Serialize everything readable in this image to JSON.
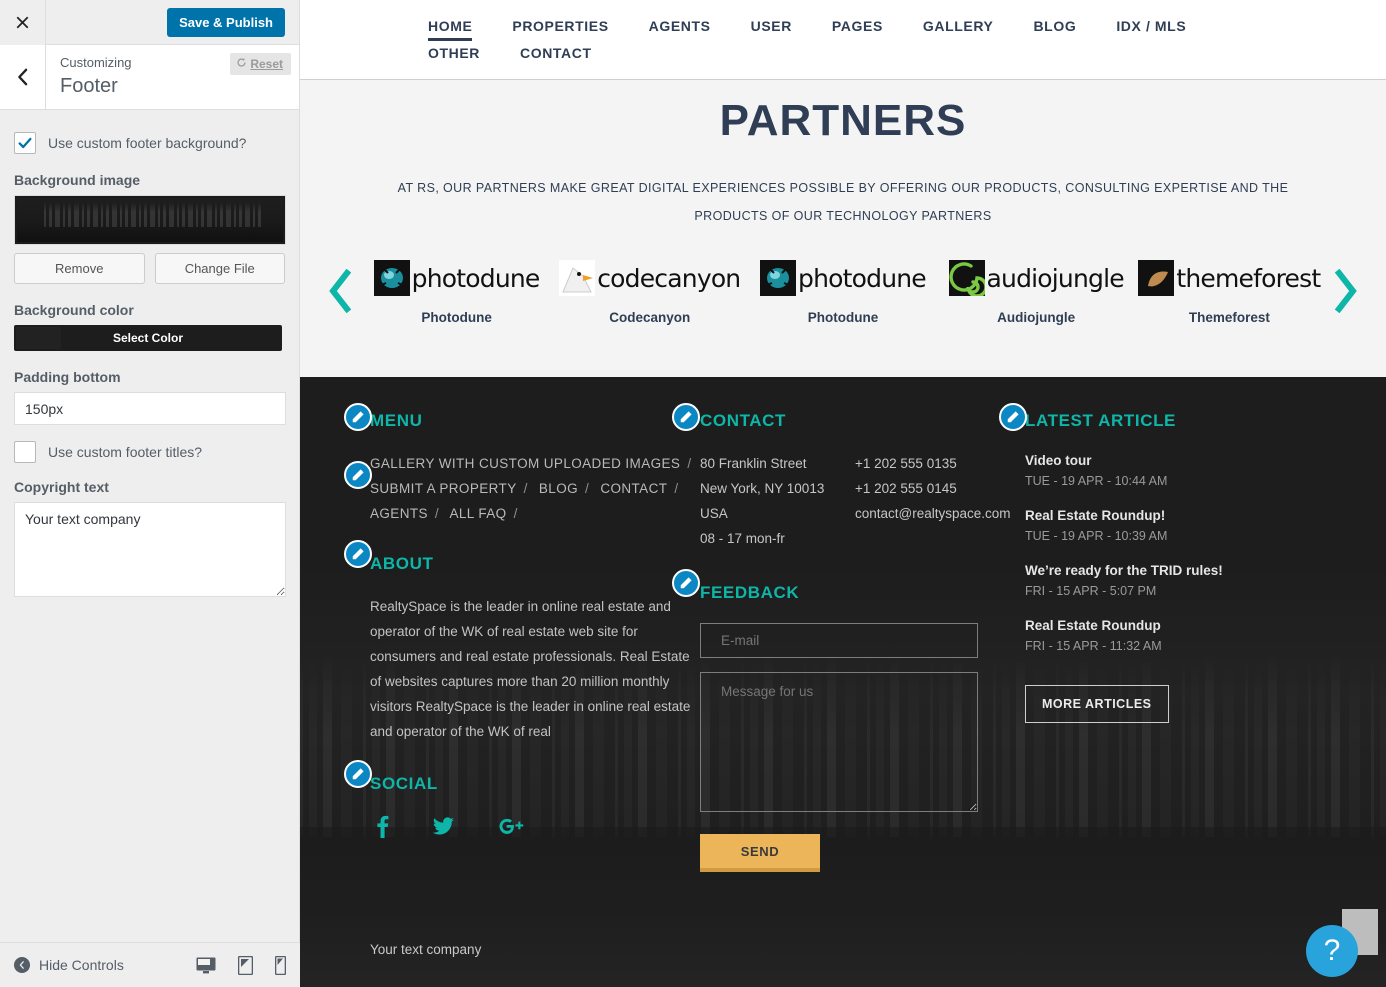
{
  "sidebar": {
    "close_icon": "close-icon",
    "save_button": "Save & Publish",
    "back_icon": "chevron-left-icon",
    "customizing_label": "Customizing",
    "panel_title": "Footer",
    "reset_button": "Reset",
    "controls": {
      "custom_bg_checkbox_label": "Use custom footer background?",
      "custom_bg_checked": true,
      "background_image_label": "Background image",
      "remove_button": "Remove",
      "change_file_button": "Change File",
      "background_color_label": "Background color",
      "select_color_button": "Select Color",
      "background_color_value": "#222222",
      "padding_bottom_label": "Padding bottom",
      "padding_bottom_value": "150px",
      "custom_titles_checkbox_label": "Use custom footer titles?",
      "custom_titles_checked": false,
      "copyright_label": "Copyright text",
      "copyright_value": "Your text company"
    },
    "footer_bar": {
      "hide_controls_label": "Hide Controls",
      "devices": [
        "desktop-icon",
        "tablet-icon",
        "mobile-icon"
      ]
    }
  },
  "preview": {
    "nav": {
      "items": [
        {
          "label": "HOME",
          "active": true
        },
        {
          "label": "PROPERTIES",
          "active": false
        },
        {
          "label": "AGENTS",
          "active": false
        },
        {
          "label": "USER",
          "active": false
        },
        {
          "label": "PAGES",
          "active": false
        },
        {
          "label": "GALLERY",
          "active": false
        },
        {
          "label": "BLOG",
          "active": false
        },
        {
          "label": "IDX / MLS",
          "active": false
        },
        {
          "label": "OTHER",
          "active": false
        },
        {
          "label": "CONTACT",
          "active": false
        }
      ]
    },
    "partners": {
      "title": "PARTNERS",
      "subtitle": "AT RS, OUR PARTNERS MAKE GREAT DIGITAL EXPERIENCES POSSIBLE BY OFFERING OUR PRODUCTS, CONSULTING EXPERTISE AND THE PRODUCTS OF OUR TECHNOLOGY PARTNERS",
      "prev_arrow": "chevron-left-icon",
      "next_arrow": "chevron-right-icon",
      "arrow_color": "#0db6a8",
      "items": [
        {
          "logo_word": "photodune",
          "caption": "Photodune",
          "mark": "photodune-logo-icon"
        },
        {
          "logo_word": "codecanyon",
          "caption": "Codecanyon",
          "mark": "codecanyon-logo-icon"
        },
        {
          "logo_word": "photodune",
          "caption": "Photodune",
          "mark": "photodune-logo-icon"
        },
        {
          "logo_word": "audiojungle",
          "caption": "Audiojungle",
          "mark": "audiojungle-logo-icon"
        },
        {
          "logo_word": "themeforest",
          "caption": "Themeforest",
          "mark": "themeforest-logo-icon"
        }
      ]
    },
    "footer": {
      "accent_color": "#0db6a8",
      "menu": {
        "heading": "MENU",
        "links": [
          "GALLERY WITH CUSTOM UPLOADED IMAGES",
          "SUBMIT A PROPERTY",
          "BLOG",
          "CONTACT",
          "AGENTS",
          "ALL FAQ"
        ]
      },
      "about": {
        "heading": "ABOUT",
        "text": "RealtySpace is the leader in online real estate and operator of the WK of real estate web site for consumers and real estate professionals. Real Estate of websites captures more than 20 million monthly visitors\nRealtySpace is the leader in online real estate and operator of the WK of real"
      },
      "social": {
        "heading": "SOCIAL",
        "icons": [
          "facebook-icon",
          "twitter-icon",
          "google-plus-icon"
        ]
      },
      "contact": {
        "heading": "CONTACT",
        "address": [
          "80 Franklin Street",
          "New York, NY 10013",
          "USA",
          "08 - 17 mon-fr"
        ],
        "details": [
          "+1 202 555 0135",
          "+1 202 555 0145",
          "contact@realtyspace.com"
        ]
      },
      "feedback": {
        "heading": "FEEDBACK",
        "email_placeholder": "E-mail",
        "email_value": "",
        "message_placeholder": "Message for us",
        "message_value": "",
        "send_button": "SEND",
        "send_button_color": "#edb55a"
      },
      "latest_article": {
        "heading": "LATEST ARTICLE",
        "articles": [
          {
            "title": "Video tour",
            "date": "TUE - 19 APR - 10:44 AM"
          },
          {
            "title": "Real Estate Roundup!",
            "date": "TUE - 19 APR - 10:39 AM"
          },
          {
            "title": "We’re ready for the TRID rules!",
            "date": "FRI - 15 APR - 5:07 PM"
          },
          {
            "title": "Real Estate Roundup",
            "date": "FRI - 15 APR - 11:32 AM"
          }
        ],
        "more_button": "MORE ARTICLES"
      },
      "copyright": "Your text company",
      "help_button": "?"
    }
  }
}
